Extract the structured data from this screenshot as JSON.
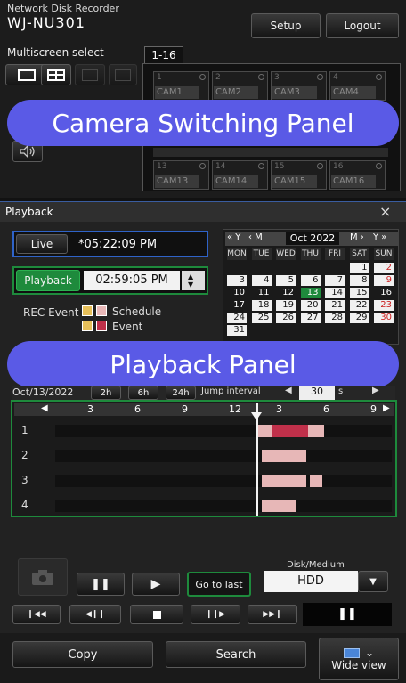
{
  "header": {
    "product": "Network Disk Recorder",
    "model": "WJ-NU301",
    "setup_label": "Setup",
    "logout_label": "Logout",
    "multiscreen_label": "Multiscreen select",
    "group_tab": "1-16",
    "cameras": [
      {
        "num": "1",
        "name": "CAM1"
      },
      {
        "num": "2",
        "name": "CAM2"
      },
      {
        "num": "3",
        "name": "CAM3"
      },
      {
        "num": "4",
        "name": "CAM4"
      },
      {
        "num": "13",
        "name": "CAM13"
      },
      {
        "num": "14",
        "name": "CAM14"
      },
      {
        "num": "15",
        "name": "CAM15"
      },
      {
        "num": "16",
        "name": "CAM16"
      }
    ]
  },
  "overlays": {
    "camera_panel": "Camera Switching Panel",
    "playback_panel": "Playback Panel"
  },
  "playback": {
    "title": "Playback",
    "close": "×",
    "live_label": "Live",
    "live_time": "*05:22:09 PM",
    "playback_label": "Playback",
    "playback_time": "02:59:05 PM",
    "rec_event_label": "REC Event",
    "legend_schedule": "Schedule",
    "legend_event": "Event",
    "calendar": {
      "month": "Oct 2022",
      "nav_prev_year": "« Y",
      "nav_prev_month": "‹ M",
      "nav_next_month": "M ›",
      "nav_next_year": "Y »",
      "days": [
        "MON",
        "TUE",
        "WED",
        "THU",
        "FRI",
        "SAT",
        "SUN"
      ],
      "rows": [
        [
          "",
          "",
          "",
          "",
          "",
          "1",
          "2"
        ],
        [
          "3",
          "4",
          "5",
          "6",
          "7",
          "8",
          "9"
        ],
        [
          "10",
          "11",
          "12",
          "13",
          "14",
          "15",
          "16"
        ],
        [
          "17",
          "18",
          "19",
          "20",
          "21",
          "22",
          "23"
        ],
        [
          "24",
          "25",
          "26",
          "27",
          "28",
          "29",
          "30"
        ],
        [
          "31",
          "",
          "",
          "",
          "",
          "",
          ""
        ]
      ],
      "selected_day": "13"
    },
    "timeline": {
      "date": "Oct/13/2022",
      "zoom_2h": "2h",
      "zoom_6h": "6h",
      "zoom_24h": "24h",
      "jump_label": "Jump interval",
      "jump_value": "30",
      "jump_unit": "s",
      "ticks": [
        "3",
        "6",
        "9",
        "12",
        "3",
        "6",
        "9"
      ],
      "rows": [
        "1",
        "2",
        "3",
        "4"
      ]
    },
    "disk_label": "Disk/Medium",
    "disk_value": "HDD",
    "go_to_last": "Go to last"
  },
  "footer": {
    "copy_label": "Copy",
    "search_label": "Search",
    "wide_view_label": "Wide view"
  },
  "colors": {
    "overlay": "#5a5ae6",
    "accent_green": "#1e8a3c",
    "schedule": "#e7b7b7",
    "event": "#c0304a"
  }
}
